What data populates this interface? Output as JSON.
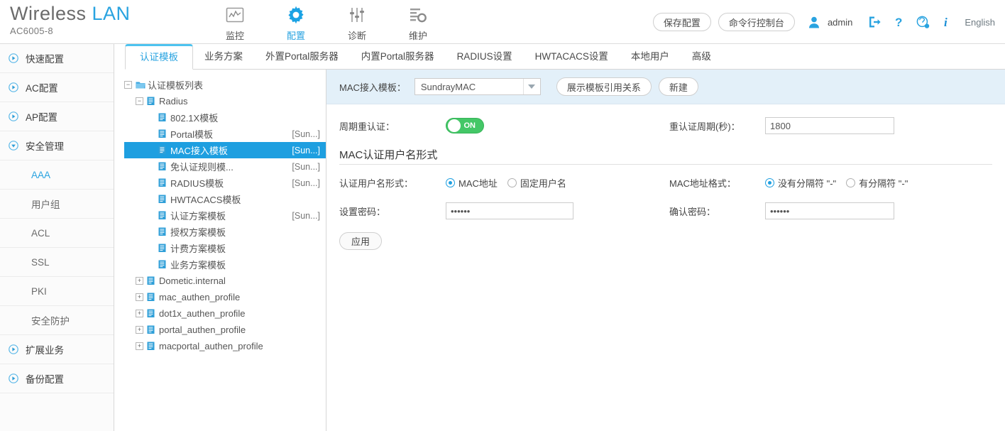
{
  "brand": {
    "name_main": "Wireless",
    "name_accent": "LAN",
    "model": "AC6005-8"
  },
  "topnav": [
    {
      "label": "监控",
      "icon": "monitor-chart-icon",
      "active": false
    },
    {
      "label": "配置",
      "icon": "gear-icon",
      "active": true
    },
    {
      "label": "诊断",
      "icon": "sliders-icon",
      "active": false
    },
    {
      "label": "维护",
      "icon": "maintenance-icon",
      "active": false
    }
  ],
  "header_right": {
    "save_config_label": "保存配置",
    "cli_console_label": "命令行控制台",
    "user_icon": "user-icon",
    "username": "admin",
    "logout_icon": "logout-icon",
    "help_icon": "question-mark-icon",
    "support_icon": "lifebuoy-icon",
    "info_icon": "info-icon",
    "language": "English"
  },
  "sidebar": [
    {
      "label": "快速配置",
      "state": "collapsed",
      "sub": false,
      "active": false
    },
    {
      "label": "AC配置",
      "state": "collapsed",
      "sub": false,
      "active": false
    },
    {
      "label": "AP配置",
      "state": "collapsed",
      "sub": false,
      "active": false
    },
    {
      "label": "安全管理",
      "state": "expanded",
      "sub": false,
      "active": false
    },
    {
      "label": "AAA",
      "state": "none",
      "sub": true,
      "active": true
    },
    {
      "label": "用户组",
      "state": "none",
      "sub": true,
      "active": false
    },
    {
      "label": "ACL",
      "state": "none",
      "sub": true,
      "active": false
    },
    {
      "label": "SSL",
      "state": "none",
      "sub": true,
      "active": false
    },
    {
      "label": "PKI",
      "state": "none",
      "sub": true,
      "active": false
    },
    {
      "label": "安全防护",
      "state": "none",
      "sub": true,
      "active": false
    },
    {
      "label": "扩展业务",
      "state": "collapsed",
      "sub": false,
      "active": false
    },
    {
      "label": "备份配置",
      "state": "collapsed",
      "sub": false,
      "active": false
    }
  ],
  "tabs": [
    {
      "label": "认证模板",
      "active": true
    },
    {
      "label": "业务方案",
      "active": false
    },
    {
      "label": "外置Portal服务器",
      "active": false
    },
    {
      "label": "内置Portal服务器",
      "active": false
    },
    {
      "label": "RADIUS设置",
      "active": false
    },
    {
      "label": "HWTACACS设置",
      "active": false
    },
    {
      "label": "本地用户",
      "active": false
    },
    {
      "label": "高级",
      "active": false
    }
  ],
  "tree": [
    {
      "label": "认证模板列表",
      "right": "",
      "indent": 0,
      "expander": "minus",
      "icon": "folder-open-icon",
      "selected": false
    },
    {
      "label": "Radius",
      "right": "",
      "indent": 1,
      "expander": "minus",
      "icon": "document-icon",
      "selected": false
    },
    {
      "label": "802.1X模板",
      "right": "",
      "indent": 2,
      "expander": "none",
      "icon": "document-icon",
      "selected": false
    },
    {
      "label": "Portal模板",
      "right": "[Sun...]",
      "indent": 2,
      "expander": "none",
      "icon": "document-icon",
      "selected": false
    },
    {
      "label": "MAC接入模板",
      "right": "[Sun...]",
      "indent": 2,
      "expander": "none",
      "icon": "document-icon",
      "selected": true
    },
    {
      "label": "免认证规则模...",
      "right": "[Sun...]",
      "indent": 2,
      "expander": "none",
      "icon": "document-icon",
      "selected": false
    },
    {
      "label": "RADIUS模板",
      "right": "[Sun...]",
      "indent": 2,
      "expander": "none",
      "icon": "document-icon",
      "selected": false
    },
    {
      "label": "HWTACACS模板",
      "right": "",
      "indent": 2,
      "expander": "none",
      "icon": "document-icon",
      "selected": false
    },
    {
      "label": "认证方案模板",
      "right": "[Sun...]",
      "indent": 2,
      "expander": "none",
      "icon": "document-icon",
      "selected": false
    },
    {
      "label": "授权方案模板",
      "right": "",
      "indent": 2,
      "expander": "none",
      "icon": "document-icon",
      "selected": false
    },
    {
      "label": "计费方案模板",
      "right": "",
      "indent": 2,
      "expander": "none",
      "icon": "document-icon",
      "selected": false
    },
    {
      "label": "业务方案模板",
      "right": "",
      "indent": 2,
      "expander": "none",
      "icon": "document-icon",
      "selected": false
    },
    {
      "label": "Dometic.internal",
      "right": "",
      "indent": 1,
      "expander": "plus",
      "icon": "document-icon",
      "selected": false
    },
    {
      "label": "mac_authen_profile",
      "right": "",
      "indent": 1,
      "expander": "plus",
      "icon": "document-icon",
      "selected": false
    },
    {
      "label": "dot1x_authen_profile",
      "right": "",
      "indent": 1,
      "expander": "plus",
      "icon": "document-icon",
      "selected": false
    },
    {
      "label": "portal_authen_profile",
      "right": "",
      "indent": 1,
      "expander": "plus",
      "icon": "document-icon",
      "selected": false
    },
    {
      "label": "macportal_authen_profile",
      "right": "",
      "indent": 1,
      "expander": "plus",
      "icon": "document-icon",
      "selected": false
    }
  ],
  "pane": {
    "template_label": "MAC接入模板：",
    "template_value": "SundrayMAC",
    "show_refs_label": "展示模板引用关系",
    "new_label": "新建",
    "periodic_reauth_label": "周期重认证：",
    "periodic_reauth_state": "ON",
    "reauth_period_label": "重认证周期(秒)：",
    "reauth_period_value": "1800",
    "section_title": "MAC认证用户名形式",
    "username_form_label": "认证用户名形式：",
    "username_form_options": [
      {
        "label": "MAC地址",
        "selected": true
      },
      {
        "label": "固定用户名",
        "selected": false
      }
    ],
    "mac_format_label": "MAC地址格式：",
    "mac_format_options": [
      {
        "label": "没有分隔符 \"-\"",
        "selected": true
      },
      {
        "label": "有分隔符 \"-\"",
        "selected": false
      }
    ],
    "set_password_label": "设置密码：",
    "set_password_value": "••••••",
    "confirm_password_label": "确认密码：",
    "confirm_password_value": "••••••",
    "apply_label": "应用"
  },
  "colors": {
    "accent": "#29a3e0",
    "selected_row": "#1e9fe0",
    "toggle_on": "#44c767",
    "pane_header": "#e3f0f9"
  }
}
